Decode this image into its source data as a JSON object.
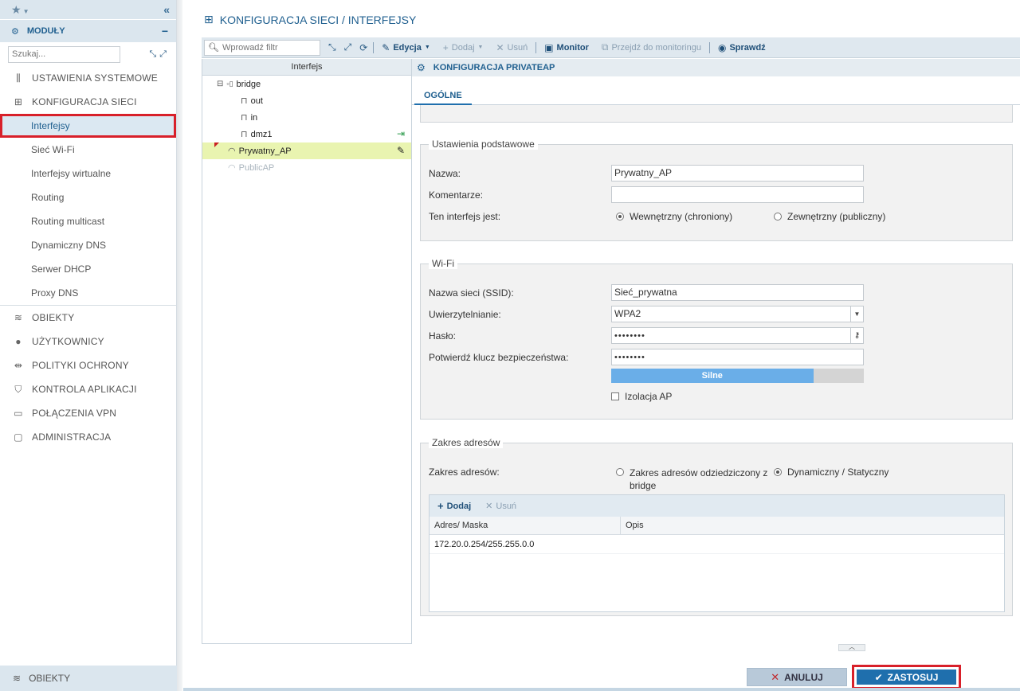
{
  "sidebar": {
    "modules_label": "MODUŁY",
    "search_placeholder": "Szukaj...",
    "sections": [
      {
        "label": "USTAWIENIA SYSTEMOWE",
        "icon": "sliders-icon"
      },
      {
        "label": "KONFIGURACJA SIECI",
        "icon": "network-icon"
      }
    ],
    "network_items": [
      "Interfejsy",
      "Sieć Wi-Fi",
      "Interfejsy wirtualne",
      "Routing",
      "Routing multicast",
      "Dynamiczny DNS",
      "Serwer DHCP",
      "Proxy DNS"
    ],
    "more_sections": [
      {
        "label": "OBIEKTY",
        "icon": "database-icon"
      },
      {
        "label": "UŻYTKOWNICY",
        "icon": "user-icon"
      },
      {
        "label": "POLITYKI OCHRONY",
        "icon": "policy-icon"
      },
      {
        "label": "KONTROLA APLIKACJI",
        "icon": "shield-icon"
      },
      {
        "label": "POŁĄCZENIA VPN",
        "icon": "vpn-icon"
      },
      {
        "label": "ADMINISTRACJA",
        "icon": "admin-icon"
      }
    ],
    "bottom_label": "OBIEKTY",
    "active_item": "Interfejsy"
  },
  "page": {
    "title": "KONFIGURACJA SIECI / INTERFEJSY"
  },
  "toolbar": {
    "filter_placeholder": "Wprowadź filtr",
    "edit": "Edycja",
    "add": "Dodaj",
    "remove": "Usuń",
    "monitor": "Monitor",
    "goto_monitoring": "Przejdź do monitoringu",
    "check": "Sprawdź"
  },
  "tree": {
    "header": "Interfejs",
    "items": [
      {
        "label": "bridge",
        "level": 0
      },
      {
        "label": "out",
        "level": 1
      },
      {
        "label": "in",
        "level": 1
      },
      {
        "label": "dmz1",
        "level": 1
      },
      {
        "label": "Prywatny_AP",
        "level": 0
      },
      {
        "label": "PublicAP",
        "level": 0
      }
    ]
  },
  "config": {
    "header": "KONFIGURACJA PRIVATEAP",
    "tab": "OGÓLNE",
    "basic": {
      "legend": "Ustawienia podstawowe",
      "name_label": "Nazwa:",
      "name_value": "Prywatny_AP",
      "comment_label": "Komentarze:",
      "comment_value": "",
      "iface_label": "Ten interfejs jest:",
      "internal": "Wewnętrzny (chroniony)",
      "external": "Zewnętrzny (publiczny)"
    },
    "wifi": {
      "legend": "Wi-Fi",
      "ssid_label": "Nazwa sieci (SSID):",
      "ssid_value": "Sieć_prywatna",
      "auth_label": "Uwierzytelnianie:",
      "auth_value": "WPA2",
      "password_label": "Hasło:",
      "password_value": "••••••••",
      "confirm_label": "Potwierdź klucz bezpieczeństwa:",
      "confirm_value": "••••••••",
      "strength_label": "Silne",
      "strength_fraction": 0.8,
      "isolation_label": "Izolacja AP"
    },
    "range": {
      "legend": "Zakres adresów",
      "label": "Zakres adresów:",
      "inherited": "Zakres adresów odziedziczony z bridge",
      "dynamic": "Dynamiczny / Statyczny",
      "add": "Dodaj",
      "remove": "Usuń",
      "col_address": "Adres/ Maska",
      "col_desc": "Opis",
      "rows": [
        {
          "address": "172.20.0.254/255.255.0.0",
          "desc": ""
        }
      ]
    }
  },
  "footer": {
    "cancel": "ANULUJ",
    "apply": "ZASTOSUJ"
  },
  "colors": {
    "accent": "#1f6fad",
    "highlight_red": "#d8202a",
    "selected_row": "#e9f4b0"
  }
}
